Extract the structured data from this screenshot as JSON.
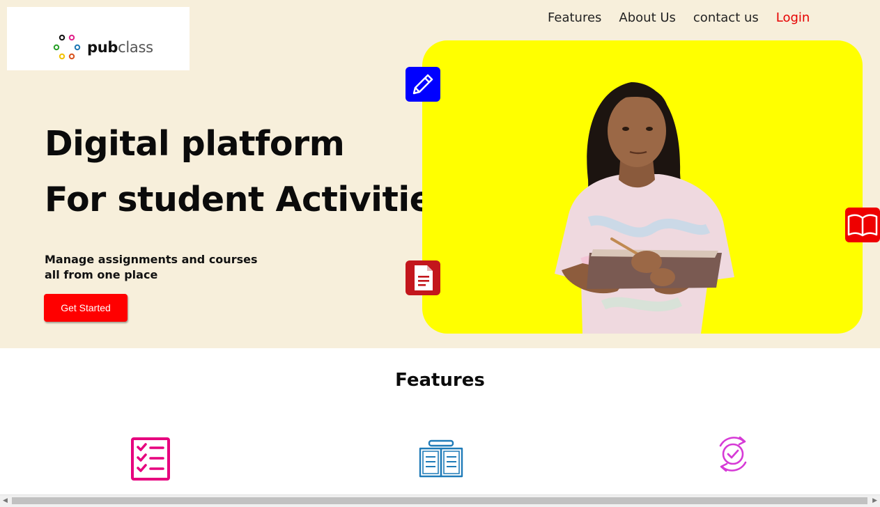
{
  "brand": {
    "logo_text_bold": "pub",
    "logo_text_regular": "class",
    "dot_colors": [
      "#111111",
      "#e0218a",
      "#2aa12a",
      "#1f78b4",
      "#f2c200",
      "#d9531e"
    ]
  },
  "nav": {
    "items": [
      {
        "label": "Features"
      },
      {
        "label": "About Us"
      },
      {
        "label": "contact us"
      }
    ],
    "login_label": "Login"
  },
  "hero": {
    "headline_line1": "Digital platform",
    "headline_line2": "For student Activities",
    "subtext": "Manage assignments and courses all from one place",
    "cta_label": "Get Started",
    "panel_color": "#ffff00",
    "background_color": "#f7efdb"
  },
  "badges": [
    {
      "icon": "pencil-icon",
      "color": "#0000ff"
    },
    {
      "icon": "document-icon",
      "color": "#c3161c"
    },
    {
      "icon": "open-book-icon",
      "color": "#ee0000"
    }
  ],
  "features": {
    "title": "Features",
    "icons": [
      {
        "icon": "checklist-icon",
        "color": "#e6007e"
      },
      {
        "icon": "book-reading-icon",
        "color": "#1f7bb8"
      },
      {
        "icon": "sync-check-icon",
        "color": "#d63ad6"
      }
    ]
  }
}
